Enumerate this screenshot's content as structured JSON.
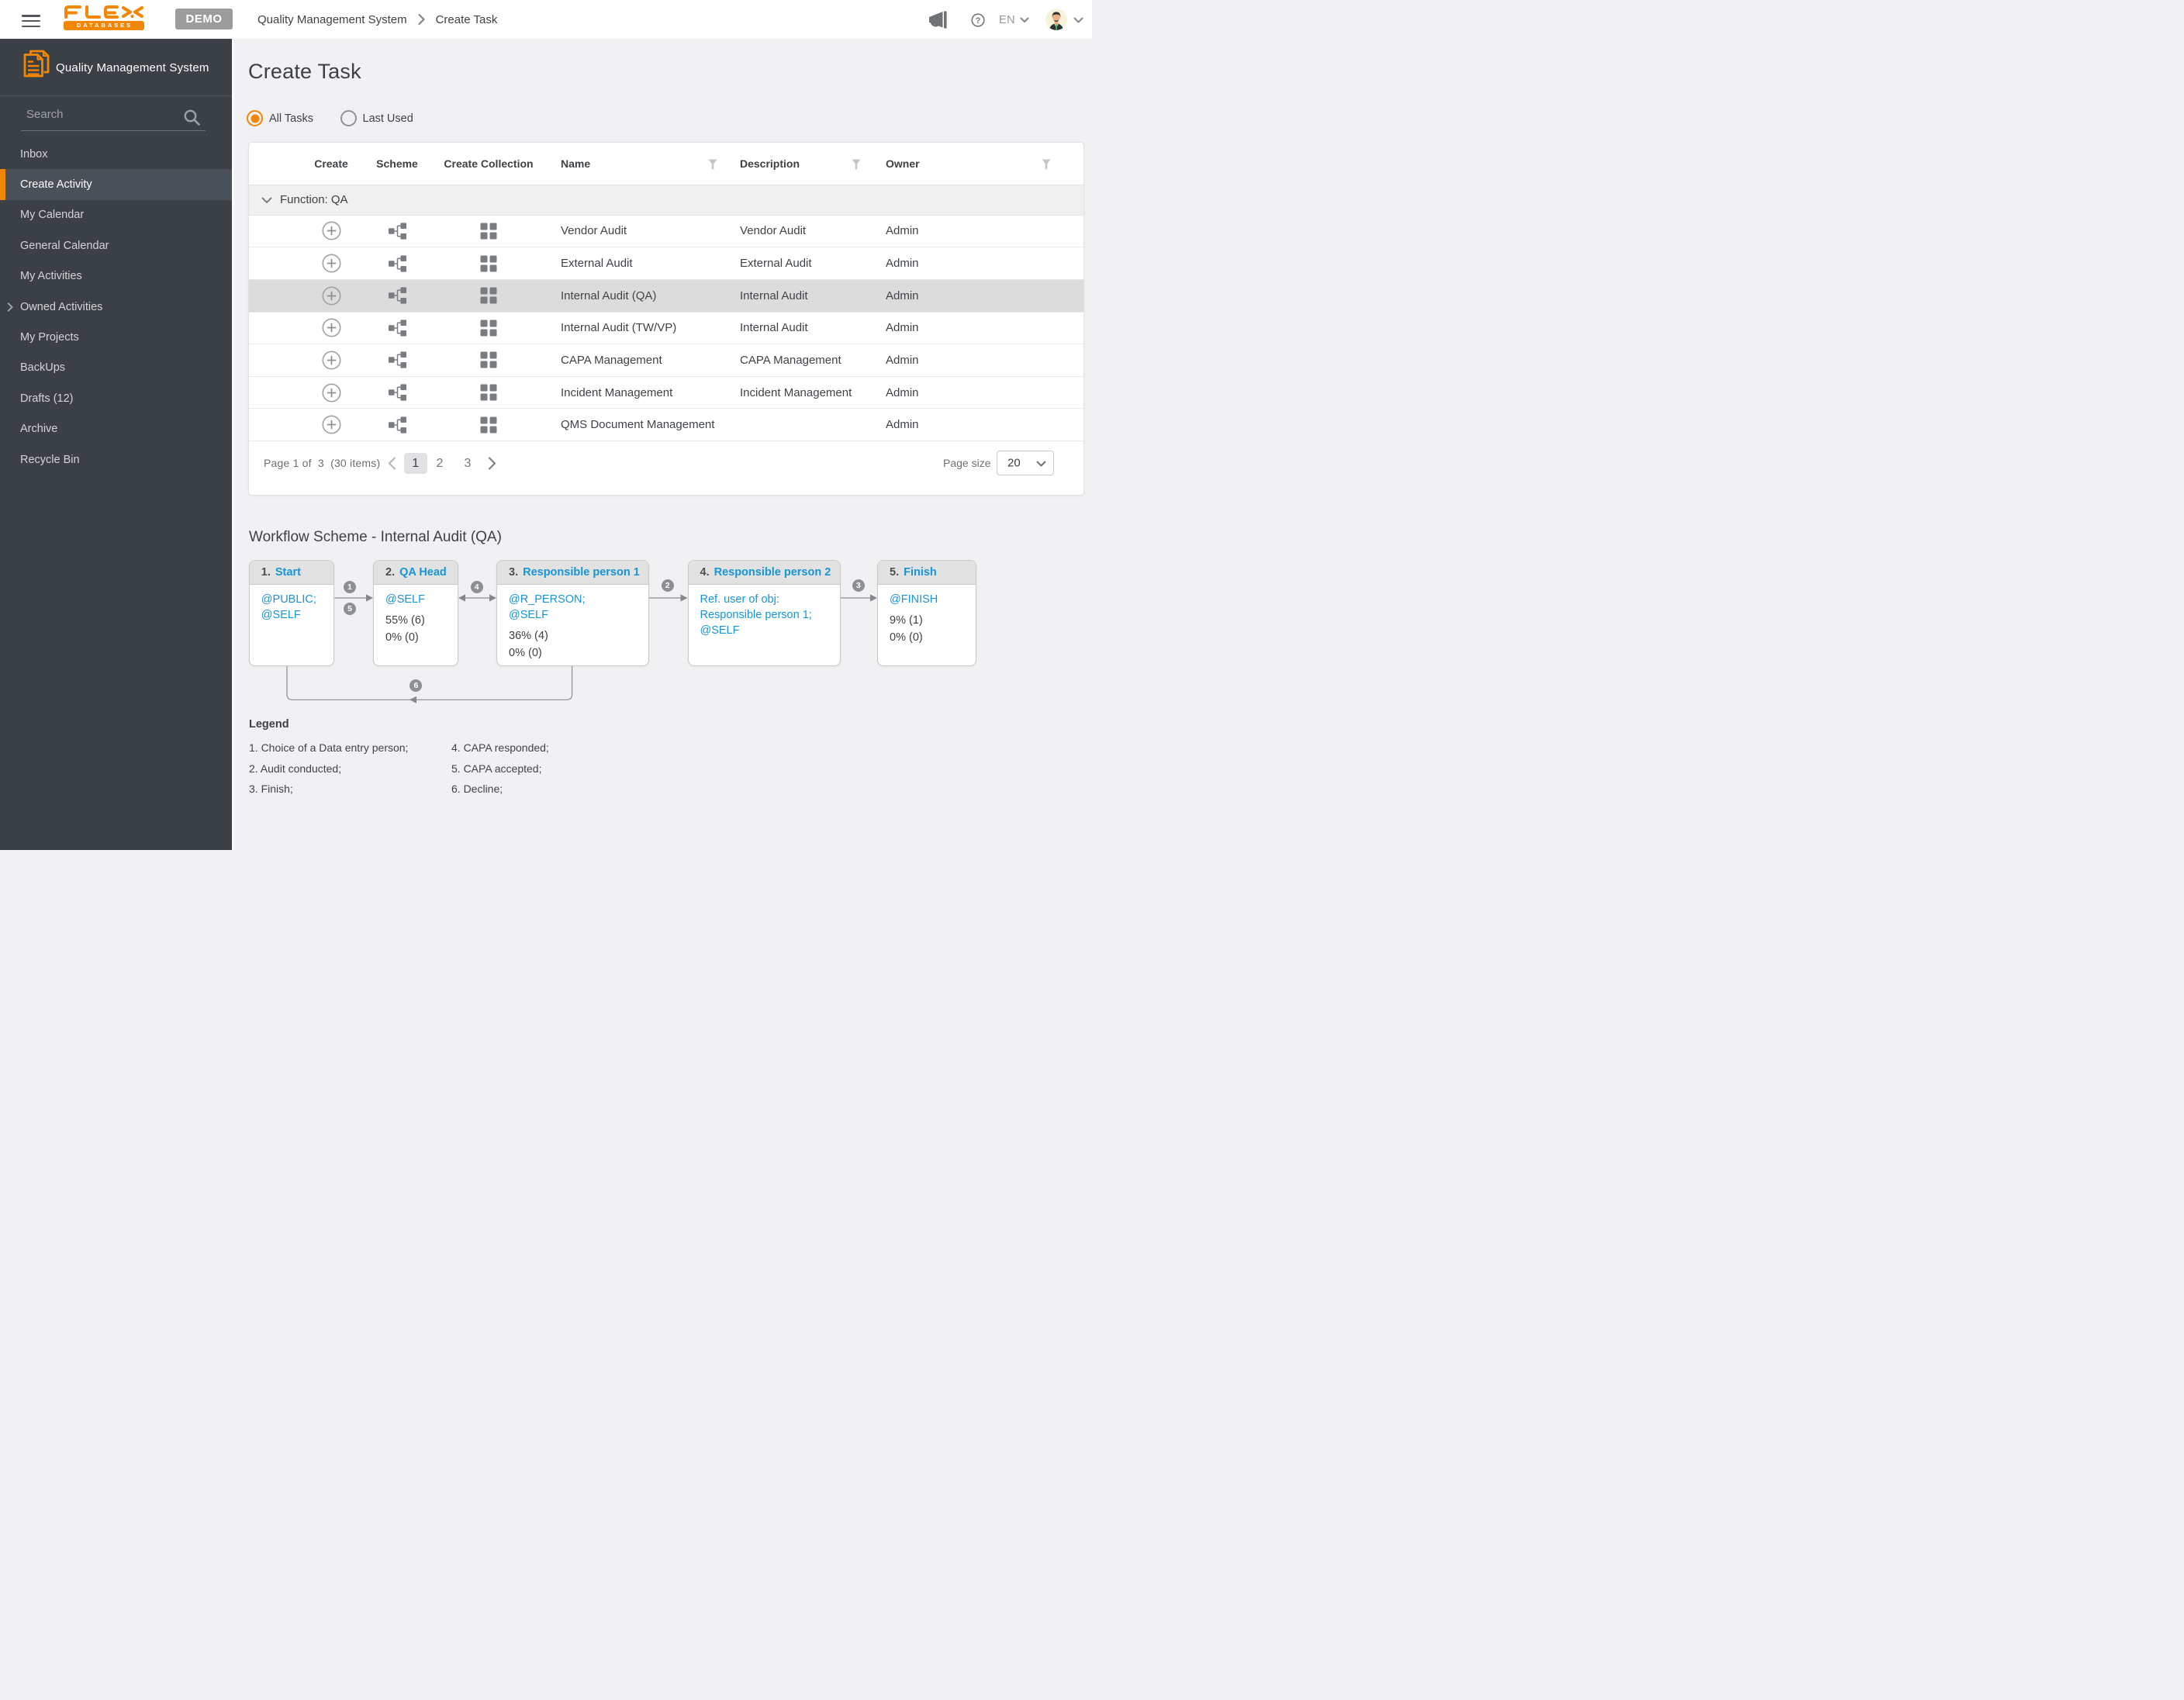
{
  "topbar": {
    "logo": {
      "brand": "FLEX",
      "sub": "DATABASES"
    },
    "demo_label": "DEMO",
    "breadcrumb": {
      "section": "Quality Management System",
      "page": "Create Task"
    },
    "language": "EN"
  },
  "sidebar": {
    "title": "Quality Management System",
    "search_placeholder": "Search",
    "items": [
      {
        "label": "Inbox"
      },
      {
        "label": "Create Activity",
        "selected": true
      },
      {
        "label": "My Calendar"
      },
      {
        "label": "General Calendar"
      },
      {
        "label": "My Activities"
      },
      {
        "label": "Owned Activities",
        "expandable": true
      },
      {
        "label": "My Projects"
      },
      {
        "label": "BackUps"
      },
      {
        "label": "Drafts (12)"
      },
      {
        "label": "Archive"
      },
      {
        "label": "Recycle Bin"
      }
    ]
  },
  "main": {
    "title": "Create Task",
    "filters": {
      "all_tasks": "All Tasks",
      "last_used": "Last Used"
    },
    "table": {
      "headers": {
        "create": "Create",
        "scheme": "Scheme",
        "create_collection": "Create Collection",
        "name": "Name",
        "description": "Description",
        "owner": "Owner"
      },
      "group_label": "Function: QA",
      "rows": [
        {
          "name": "Vendor Audit",
          "description": "Vendor Audit",
          "owner": "Admin"
        },
        {
          "name": "External Audit",
          "description": "External Audit",
          "owner": "Admin"
        },
        {
          "name": "Internal Audit (QA)",
          "description": "Internal Audit",
          "owner": "Admin",
          "selected": true
        },
        {
          "name": "Internal Audit (TW/VP)",
          "description": "Internal Audit",
          "owner": "Admin"
        },
        {
          "name": "CAPA Management",
          "description": "CAPA Management",
          "owner": "Admin"
        },
        {
          "name": "Incident Management",
          "description": "Incident Management",
          "owner": "Admin"
        },
        {
          "name": "QMS Document Management",
          "description": "",
          "owner": "Admin"
        }
      ]
    },
    "pagination": {
      "summary": "Page 1 of  3  (30 items)",
      "pages": [
        "1",
        "2",
        "3"
      ],
      "current_page": "1",
      "page_size_label": "Page size",
      "page_size": "20"
    }
  },
  "workflow": {
    "title": "Workflow Scheme - Internal Audit (QA)",
    "nodes": [
      {
        "num": "1.",
        "name": "Start",
        "acl": "@PUBLIC;\n@SELF"
      },
      {
        "num": "2.",
        "name": "QA Head",
        "acl": "@SELF",
        "stats": [
          "55% (6)",
          "0% (0)"
        ]
      },
      {
        "num": "3.",
        "name": "Responsible person 1",
        "acl": "@R_PERSON;\n@SELF",
        "stats": [
          "36% (4)",
          "0% (0)"
        ]
      },
      {
        "num": "4.",
        "name": "Responsible person 2",
        "acl": "Ref. user of obj:\nResponsible person 1;\n@SELF"
      },
      {
        "num": "5.",
        "name": "Finish",
        "acl": "@FINISH",
        "stats": [
          "9% (1)",
          "0% (0)"
        ]
      }
    ],
    "transitions": [
      "1",
      "5",
      "4",
      "2",
      "3",
      "6"
    ],
    "legend": {
      "title": "Legend",
      "col1": [
        "1. Choice of a Data entry person;",
        "2. Audit conducted;",
        "3. Finish;"
      ],
      "col2": [
        "4. CAPA responded;",
        "5. CAPA accepted;",
        "6. Decline;"
      ]
    }
  },
  "colors": {
    "accent_orange": "#f08705",
    "link_blue": "#1795d4",
    "sidebar_bg": "#3a4045",
    "selected_row": "#dcdcdd"
  }
}
